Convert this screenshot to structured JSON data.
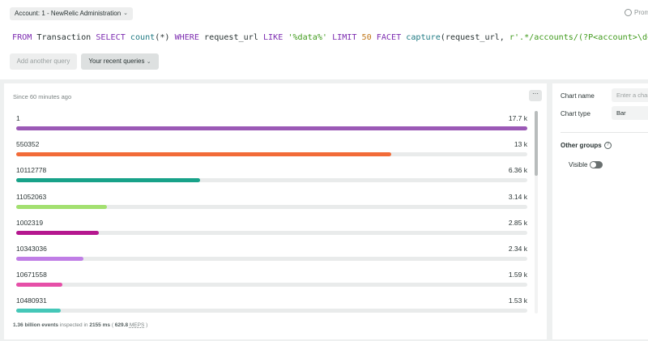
{
  "header": {
    "account_label": "Account: 1 - NewRelic Administration",
    "promote_label": "Promote"
  },
  "query": {
    "kw_from": "FROM",
    "table": "Transaction",
    "kw_select": "SELECT",
    "fn_count": "count",
    "count_arg": "(*)",
    "kw_where": "WHERE",
    "field": "request_url",
    "kw_like": "LIKE",
    "like_str": "'%data%'",
    "kw_limit": "LIMIT",
    "limit_num": "50",
    "kw_facet": "FACET",
    "fn_capture": "capture",
    "capture_open": "(request_url, ",
    "capture_regex": "r'.*/accounts/(?P<account>\\d+).*'",
    "capture_close": ")"
  },
  "toolbar": {
    "add_query_label": "Add another query",
    "recent_queries_label": "Your recent queries"
  },
  "chart": {
    "since_label": "Since 60 minutes ago",
    "more_label": "···"
  },
  "chart_data": {
    "type": "bar",
    "categories": [
      "1",
      "550352",
      "10112778",
      "11052063",
      "1002319",
      "10343036",
      "10671558",
      "10480931"
    ],
    "values": [
      17700,
      13000,
      6360,
      3140,
      2850,
      2340,
      1590,
      1530
    ],
    "value_labels": [
      "17.7 k",
      "13 k",
      "6.36 k",
      "3.14 k",
      "2.85 k",
      "2.34 k",
      "1.59 k",
      "1.53 k"
    ],
    "colors": [
      "#9b59b6",
      "#f26b38",
      "#18a289",
      "#a3e070",
      "#b5178f",
      "#c07ee6",
      "#e64fa8",
      "#45c7b8"
    ],
    "xlim": [
      0,
      17700
    ]
  },
  "footer": {
    "events": "1.36 billion events",
    "inspected_prefix": "inspected in",
    "ms": "2155 ms",
    "open_paren": "(",
    "meps_value": "629.8",
    "meps_unit": "MEPS",
    "close_paren": ")"
  },
  "sidebar": {
    "chart_name_label": "Chart name",
    "chart_name_placeholder": "Enter a chart name",
    "chart_type_label": "Chart type",
    "chart_type_value": "Bar",
    "other_groups_label": "Other groups",
    "help_glyph": "?",
    "visible_label": "Visible"
  }
}
